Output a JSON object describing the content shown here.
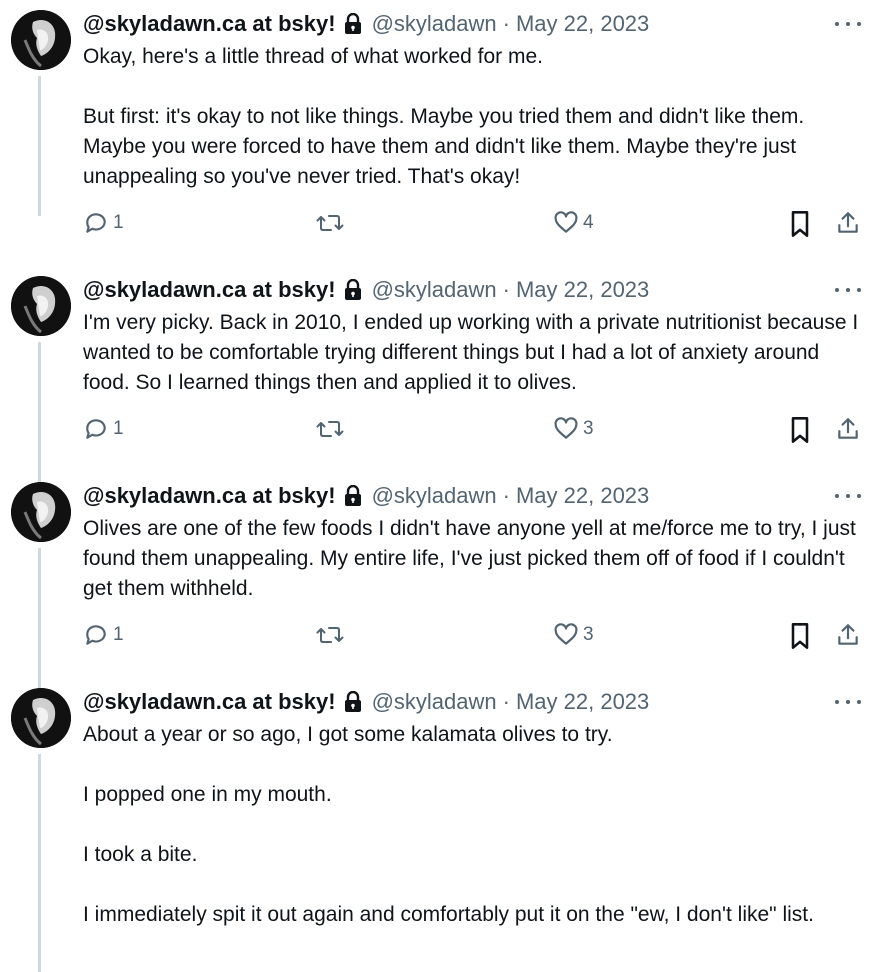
{
  "posts": [
    {
      "author": "@skyladawn.ca at bsky!",
      "handle": "@skyladawn",
      "separator": "·",
      "date": "May 22, 2023",
      "paragraphs": [
        "Okay, here's a little thread of what worked for me.",
        "But first: it's okay to not like things. Maybe you tried them and didn't like them. Maybe you were forced to have them and didn't like them. Maybe they're just unappealing so you've never tried. That's okay!"
      ],
      "replies": "1",
      "likes": "4"
    },
    {
      "author": "@skyladawn.ca at bsky!",
      "handle": "@skyladawn",
      "separator": "·",
      "date": "May 22, 2023",
      "paragraphs": [
        "I'm very picky. Back in 2010, I ended up working with a private nutritionist because I wanted to be comfortable trying different things but I had a lot of anxiety around food. So I learned things then and applied it to olives."
      ],
      "replies": "1",
      "likes": "3"
    },
    {
      "author": "@skyladawn.ca at bsky!",
      "handle": "@skyladawn",
      "separator": "·",
      "date": "May 22, 2023",
      "paragraphs": [
        "Olives are one of the few foods I didn't have anyone yell at me/force me to try, I just found them unappealing. My entire life, I've just picked them off of food if I couldn't get them withheld."
      ],
      "replies": "1",
      "likes": "3"
    },
    {
      "author": "@skyladawn.ca at bsky!",
      "handle": "@skyladawn",
      "separator": "·",
      "date": "May 22, 2023",
      "paragraphs": [
        "About a year or so ago, I got some kalamata olives to try.",
        "I popped one in my mouth.",
        "I took a bite.",
        "I immediately spit it out again and comfortably put it on the \"ew, I don't like\" list."
      ]
    }
  ],
  "icons": {
    "reply": "reply-icon",
    "repost": "repost-icon",
    "like": "heart-icon",
    "bookmark": "bookmark-icon",
    "share": "share-icon",
    "more": "more-icon",
    "lock": "lock-icon"
  },
  "colors": {
    "text": "#0f1419",
    "secondary": "#536471",
    "thread_line": "#cfd9de"
  }
}
